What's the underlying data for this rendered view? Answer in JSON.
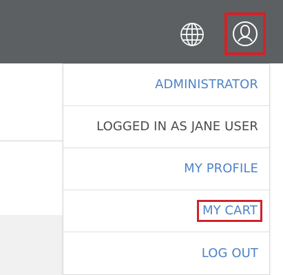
{
  "header": {
    "globe_icon": "globe-icon",
    "user_icon": "user-circle-icon",
    "highlight_color": "#d1222a",
    "bar_color": "#5d6062"
  },
  "user_menu": {
    "items": [
      {
        "label": "ADMINISTRATOR",
        "type": "link"
      },
      {
        "label": "LOGGED IN AS JANE USER",
        "type": "status"
      },
      {
        "label": "MY PROFILE",
        "type": "link"
      },
      {
        "label": "MY CART",
        "type": "link",
        "highlighted": true
      },
      {
        "label": "LOG OUT",
        "type": "link"
      }
    ],
    "link_color": "#4f83c6",
    "text_color": "#4a4a4a"
  }
}
